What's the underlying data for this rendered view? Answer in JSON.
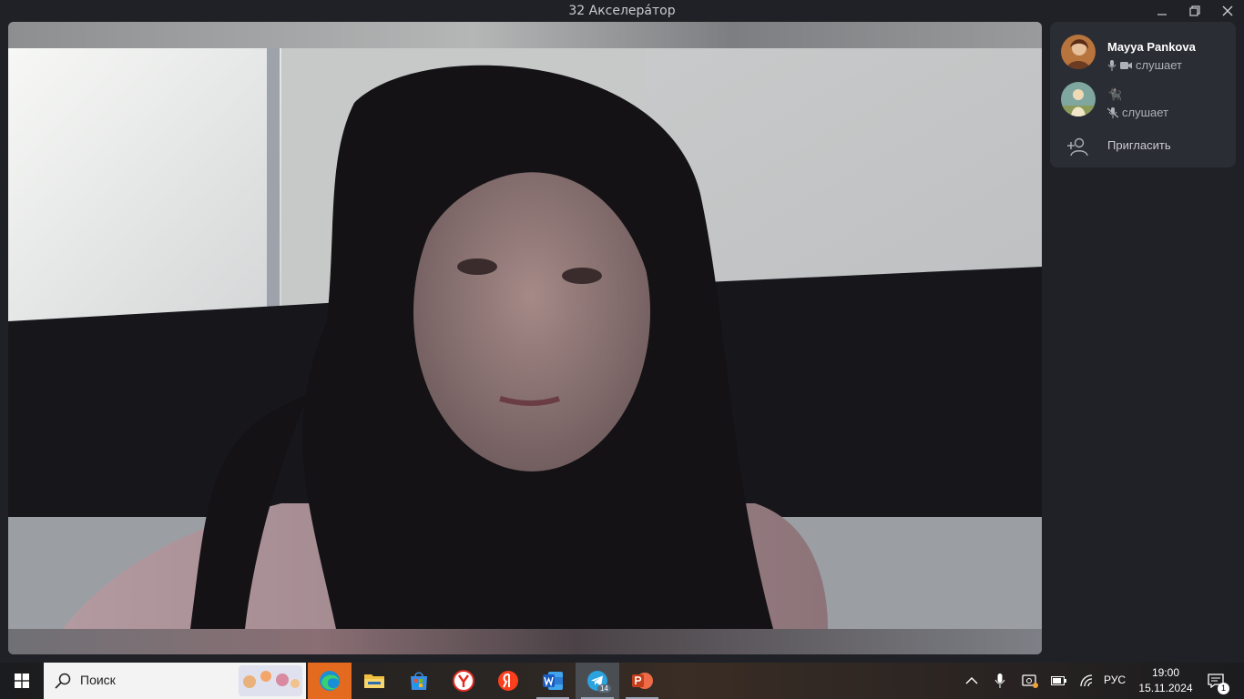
{
  "window": {
    "title": "32 Акселерáтор",
    "minimize_icon": "minimize-icon",
    "restore_icon": "restore-icon",
    "close_icon": "close-icon"
  },
  "participants": [
    {
      "name": "Mayya Pankova",
      "status": "слушает",
      "icons": [
        "mic-icon",
        "camera-icon"
      ]
    },
    {
      "name": "🐈‍⬛",
      "status": "слушает",
      "icons": [
        "mic-muted-icon"
      ]
    }
  ],
  "invite": {
    "label": "Пригласить",
    "icon": "add-user-icon"
  },
  "taskbar": {
    "search_placeholder": "Поиск",
    "apps": [
      "edge-icon",
      "file-explorer-icon",
      "store-icon",
      "yandex-browser-icon",
      "yandex-icon",
      "word-icon",
      "telegram-icon",
      "powerpoint-icon"
    ],
    "telegram_badge": "14",
    "language": "РУС",
    "time": "19:00",
    "date": "15.11.2024",
    "notifications_count": "1"
  },
  "colors": {
    "panel": "#2a2d33",
    "background": "#1f2126",
    "status_text": "#aeb1b7"
  }
}
